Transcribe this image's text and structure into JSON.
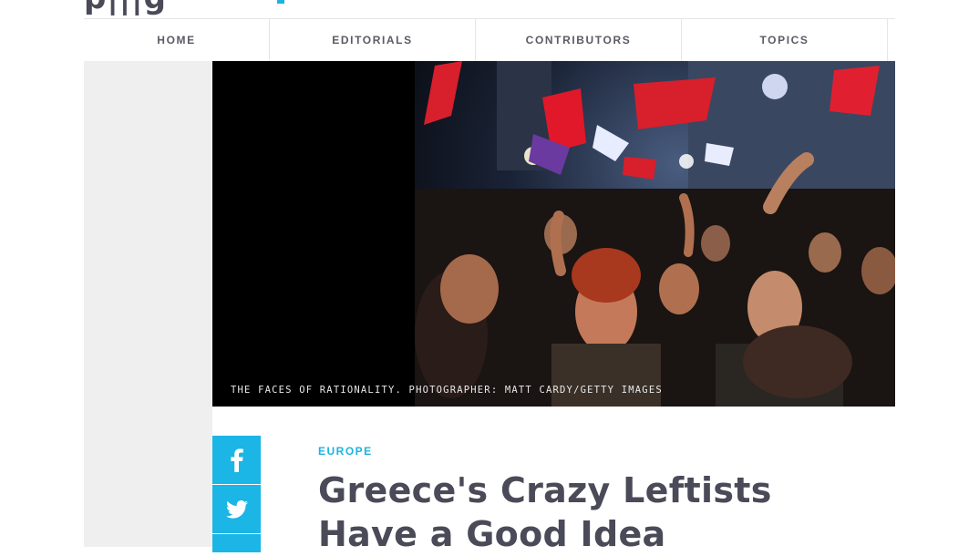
{
  "nav": {
    "items": [
      {
        "label": "HOME"
      },
      {
        "label": "EDITORIALS"
      },
      {
        "label": "CONTRIBUTORS"
      },
      {
        "label": "TOPICS"
      }
    ]
  },
  "hero": {
    "caption": "THE FACES OF RATIONALITY. PHOTOGRAPHER: MATT CARDY/GETTY IMAGES"
  },
  "share": {
    "buttons": [
      {
        "icon": "facebook-icon",
        "color": "#1bb5e6"
      },
      {
        "icon": "twitter-icon",
        "color": "#1bb5e6"
      }
    ]
  },
  "article": {
    "category": "EUROPE",
    "headline_line1": "Greece's Crazy Leftists",
    "headline_line2": "Have a Good Idea"
  },
  "colors": {
    "accent": "#1cb3e0",
    "headline": "#4a4a58",
    "nav_text": "#5b5b66",
    "gutter": "#efefef"
  }
}
